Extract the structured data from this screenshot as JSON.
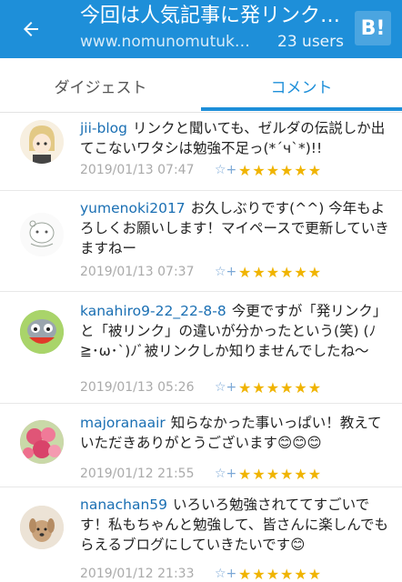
{
  "header": {
    "title": "今回は人気記事に発リンク…",
    "url": "www.nomunomutuk…",
    "users": "23 users",
    "bookmark_label": "B!"
  },
  "tabs": [
    {
      "label": "ダイジェスト"
    },
    {
      "label": "コメント"
    }
  ],
  "comments": [
    {
      "user": "jii-blog",
      "text": "リンクと聞いても、ゼルダの伝説しか出てこないワタシは勉強不足っ(*´ч`*)!!",
      "date": "2019/01/13 07:47",
      "stars": "★★★★★★"
    },
    {
      "user": "yumenoki2017",
      "text": "お久しぶりです(^^) 今年もよろしくお願いします！マイペースで更新していきますねー",
      "date": "2019/01/13 07:37",
      "stars": "★★★★★★"
    },
    {
      "user": "kanahiro9-22_22-8-8",
      "text": "今更ですが「発リンク」と「被リンク」の違いが分かったという(笑) (ﾉ≧･ω･`)ﾉﾞ被リンクしか知りませんでしたね～",
      "date": "2019/01/13 05:26",
      "stars": "★★★★★★"
    },
    {
      "user": "majoranaair",
      "text": "知らなかった事いっぱい！教えていただきありがとうございます😊😊😊",
      "date": "2019/01/12 21:55",
      "stars": "★★★★★★"
    },
    {
      "user": "nanachan59",
      "text": "いろいろ勉強されててすごいです！私もちゃんと勉強して、皆さんに楽しんでもらえるブログにしていきたいです😊",
      "date": "2019/01/12 21:33",
      "stars": "★★★★★★"
    }
  ],
  "colors": {
    "brand": "#1e8fd9",
    "star": "#f0b400",
    "username": "#1a6fb3"
  }
}
